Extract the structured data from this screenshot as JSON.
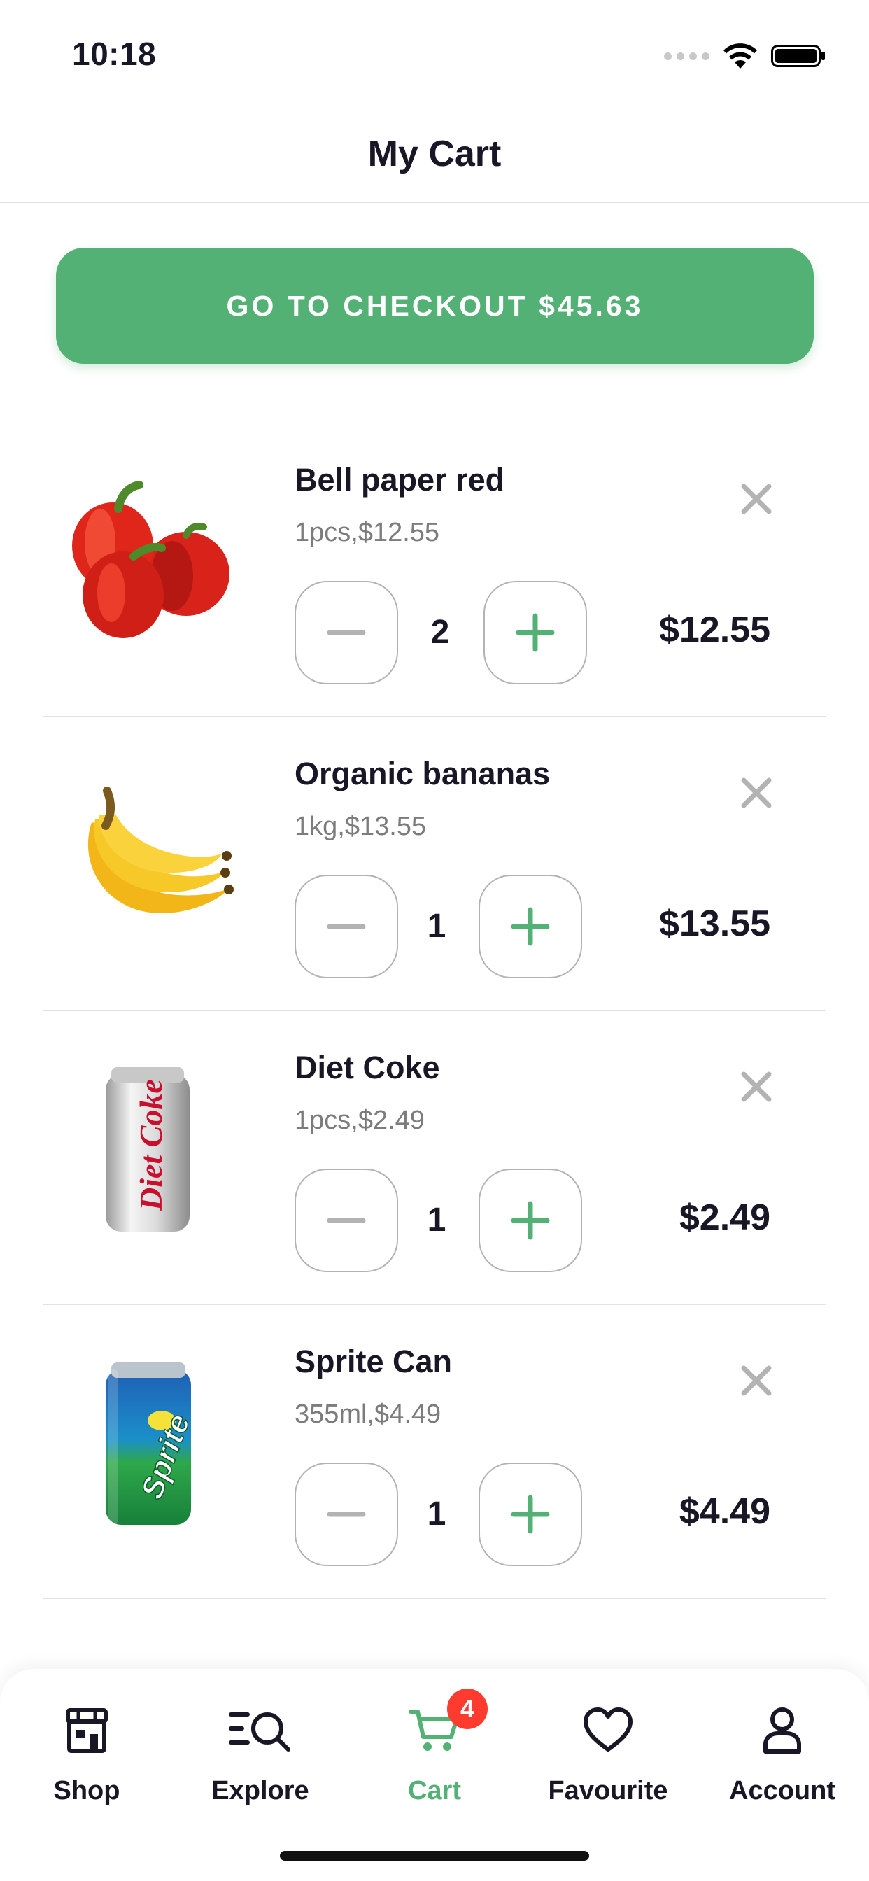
{
  "status_bar": {
    "time": "10:18"
  },
  "header": {
    "title": "My Cart"
  },
  "checkout": {
    "label": "GO TO CHECKOUT",
    "total": "$45.63"
  },
  "cart": {
    "items": [
      {
        "name": "Bell paper red",
        "detail": "1pcs,$12.55",
        "quantity": "2",
        "price": "$12.55",
        "image": "red-bell-peppers"
      },
      {
        "name": "Organic bananas",
        "detail": "1kg,$13.55",
        "quantity": "1",
        "price": "$13.55",
        "image": "banana-bunch"
      },
      {
        "name": "Diet Coke",
        "detail": "1pcs,$2.49",
        "quantity": "1",
        "price": "$2.49",
        "image": "diet-coke-can",
        "image_text": "Diet Coke"
      },
      {
        "name": "Sprite Can",
        "detail": "355ml,$4.49",
        "quantity": "1",
        "price": "$4.49",
        "image": "sprite-can",
        "image_text": "Sprite"
      }
    ]
  },
  "tab_bar": {
    "tabs": [
      {
        "label": "Shop",
        "icon": "store-icon"
      },
      {
        "label": "Explore",
        "icon": "explore-icon"
      },
      {
        "label": "Cart",
        "icon": "cart-icon",
        "badge": "4",
        "active": true
      },
      {
        "label": "Favourite",
        "icon": "heart-icon"
      },
      {
        "label": "Account",
        "icon": "user-icon"
      }
    ]
  },
  "colors": {
    "accent": "#53b175",
    "text": "#181725",
    "muted": "#7c7c7c",
    "badge": "#ff3b30",
    "divider": "#e2e2e2"
  }
}
